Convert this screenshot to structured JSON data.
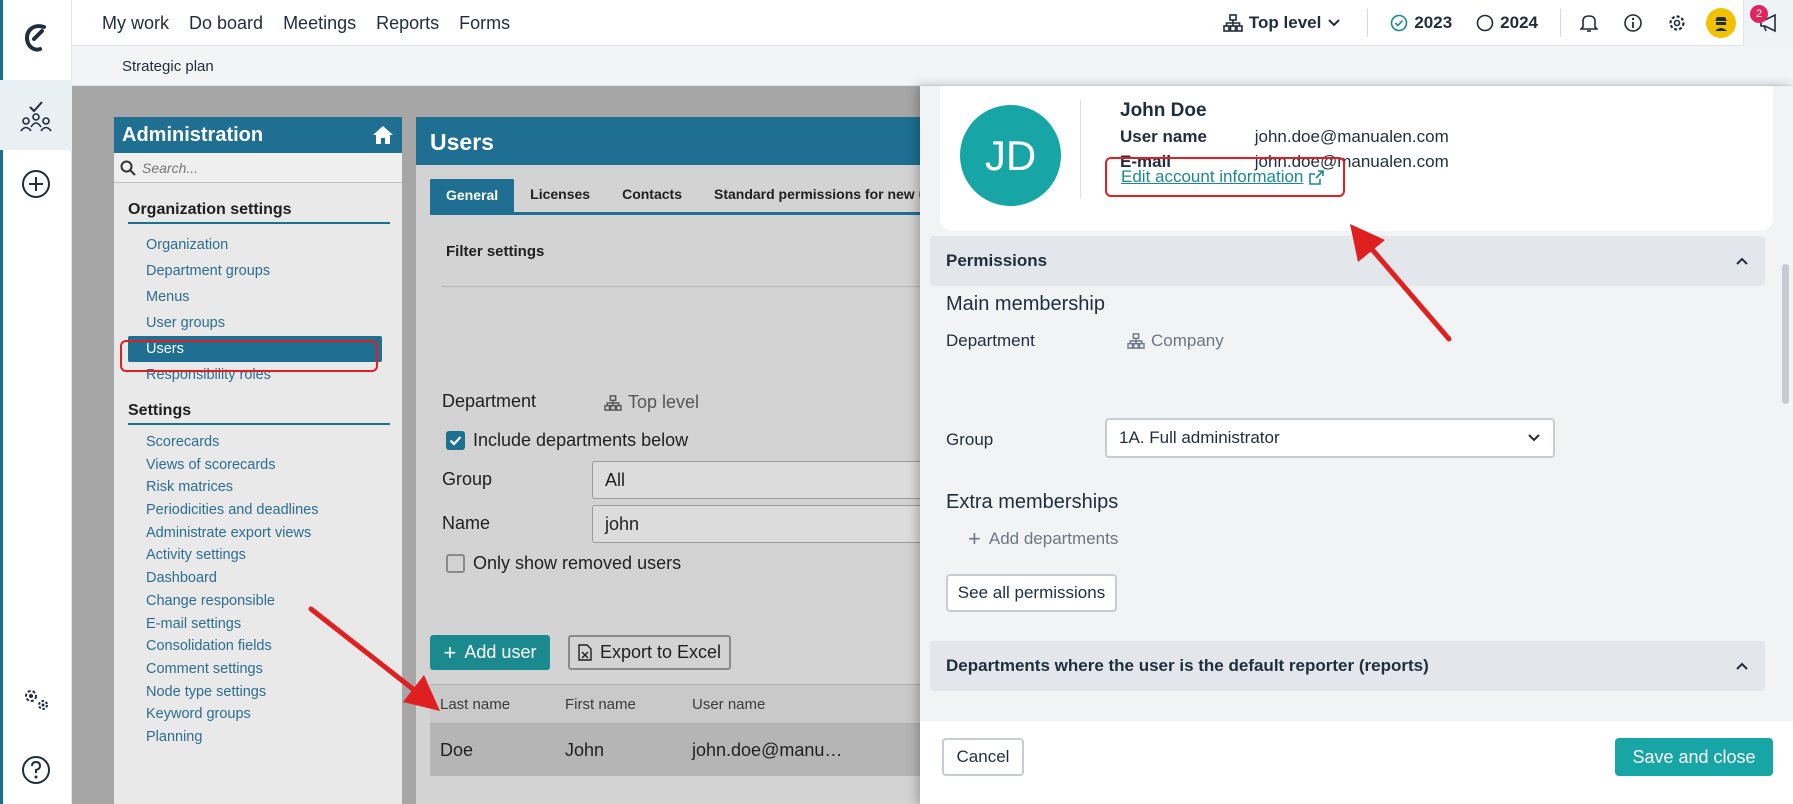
{
  "topnav": {
    "items": [
      "My work",
      "Do board",
      "Meetings",
      "Reports",
      "Forms"
    ],
    "top_level": "Top level",
    "year_current": "2023",
    "year_next": "2024",
    "notification_count": "2"
  },
  "subbar": {
    "label": "Strategic plan"
  },
  "admin": {
    "title": "Administration",
    "search_placeholder": "Search...",
    "org_title": "Organization settings",
    "org_items": [
      "Organization",
      "Department groups",
      "Menus",
      "User groups",
      "Users",
      "Responsibility roles"
    ],
    "settings_title": "Settings",
    "settings_items": [
      "Scorecards",
      "Views of scorecards",
      "Risk matrices",
      "Periodicities and deadlines",
      "Administrate export views",
      "Activity settings",
      "Dashboard",
      "Change responsible",
      "E-mail settings",
      "Consolidation fields",
      "Comment settings",
      "Node type settings",
      "Keyword groups",
      "Planning"
    ]
  },
  "users": {
    "title": "Users",
    "tabs": [
      "General",
      "Licenses",
      "Contacts",
      "Standard permissions for new us"
    ],
    "filter_title": "Filter settings",
    "department_label": "Department",
    "department_value": "Top level",
    "include_label": "Include departments below",
    "group_label": "Group",
    "group_value": "All",
    "name_label": "Name",
    "name_value": "john",
    "removed_label": "Only show removed users",
    "add_user": "Add user",
    "export": "Export to Excel",
    "columns": [
      "Last name",
      "First name",
      "User name"
    ],
    "row": [
      "Doe",
      "John",
      "john.doe@manu…"
    ]
  },
  "drawer": {
    "initials": "JD",
    "full_name": "John Doe",
    "username_label": "User name",
    "username_value": "john.doe@manualen.com",
    "email_label": "E-mail",
    "email_value": "john.doe@manualen.com",
    "edit_account": "Edit account information",
    "permissions_title": "Permissions",
    "main_membership": "Main membership",
    "department_label": "Department",
    "department_value": "Company",
    "group_label": "Group",
    "group_value": "1A. Full administrator",
    "extra_memberships": "Extra memberships",
    "add_departments": "Add departments",
    "see_all": "See all permissions",
    "reporter_title": "Departments where the user is the default reporter (reports)",
    "cancel": "Cancel",
    "save_close": "Save and close"
  },
  "colors": {
    "brand": "#1e6f92",
    "teal": "#17a5a5",
    "annotation": "#e02020"
  }
}
